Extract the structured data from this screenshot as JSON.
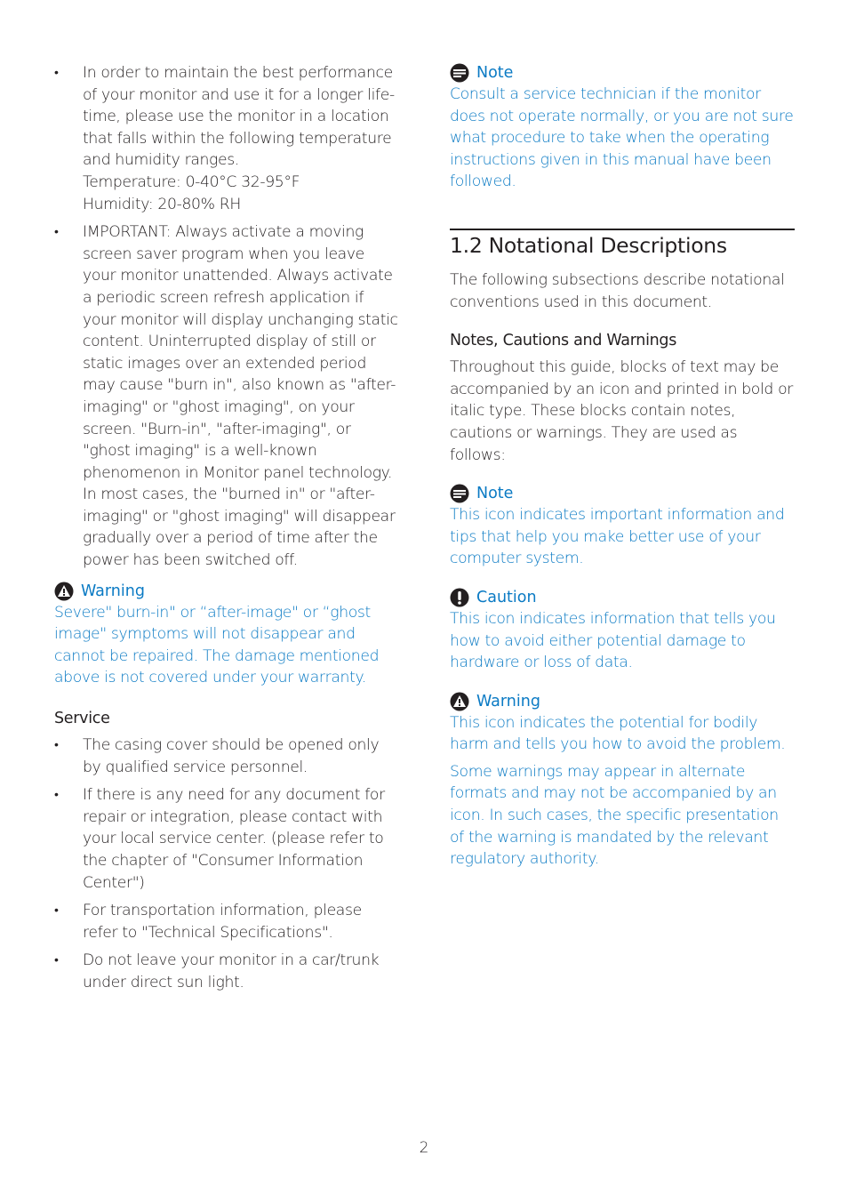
{
  "left_column": {
    "intro_bullets": [
      {
        "lines": [
          "In order to maintain the best performance of your monitor and use it for a longer life-time, please use the monitor in a location that falls within the following temperature and humidity ranges."
        ],
        "temperature": "Temperature: 0-40°C 32-95°F",
        "humidity": "Humidity: 20-80% RH"
      },
      {
        "text": "IMPORTANT: Always activate a moving screen saver program when you leave your monitor unattended. Always activate a periodic screen refresh application if your monitor will display unchanging static content. Uninterrupted display of still or static images over an extended period may cause \"burn in\", also known as \"after-imaging\" or \"ghost imaging\", on your screen. \"Burn-in\", \"after-imaging\", or \"ghost imaging\" is a well-known phenomenon in Monitor panel technology. In most cases, the \"burned in\" or \"after-imaging\" or \"ghost imaging\" will disappear gradually over a period of time after the power has been switched off."
      }
    ],
    "warning": {
      "icon": "warning-triangle-icon",
      "title": "Warning",
      "text": "Severe\" burn-in\" or “after-image\" or “ghost image\" symptoms will not disappear and cannot be repaired. The damage mentioned above is not covered under your warranty."
    },
    "service": {
      "heading": "Service",
      "bullets": [
        "The casing cover should be opened only by qualified service personnel.",
        "If there is any need for any document for repair or integration, please contact with your local service center. (please refer to the chapter of \"Consumer Information Center\")",
        "For transportation information, please refer to \"Technical Specifications\".",
        "Do not leave your monitor in a car/trunk under direct sun light."
      ]
    }
  },
  "right_column": {
    "note_top": {
      "icon": "note-icon",
      "title": "Note",
      "text": "Consult a service technician if the monitor does not operate normally, or you are not sure what procedure to take when the operating instructions given in this manual have been followed."
    },
    "section": {
      "title": "1.2  Notational Descriptions",
      "intro": "The following subsections describe notational conventions used in this document.",
      "subheading": "Notes, Cautions and Warnings",
      "body": "Throughout this guide, blocks of text may be accompanied by an icon and printed in bold or italic type. These blocks contain notes, cautions or warnings. They are used as follows:"
    },
    "note": {
      "icon": "note-icon",
      "title": "Note",
      "text": "This icon indicates important information and tips that help you make better use of your computer system."
    },
    "caution": {
      "icon": "caution-icon",
      "title": "Caution",
      "text": "This icon indicates information that tells you how to avoid either potential damage to hardware or loss of data."
    },
    "warning": {
      "icon": "warning-triangle-icon",
      "title": "Warning",
      "text": "This icon indicates the potential for bodily harm and tells you how to avoid the problem.",
      "text2": "Some warnings may appear in alternate formats and may not be accompanied by an icon. In such cases, the specific presentation of the warning is mandated by the relevant regulatory authority."
    }
  },
  "footer": {
    "page_number": "2"
  },
  "colors": {
    "text": "#231f20",
    "accent": "#0a7ac4"
  }
}
